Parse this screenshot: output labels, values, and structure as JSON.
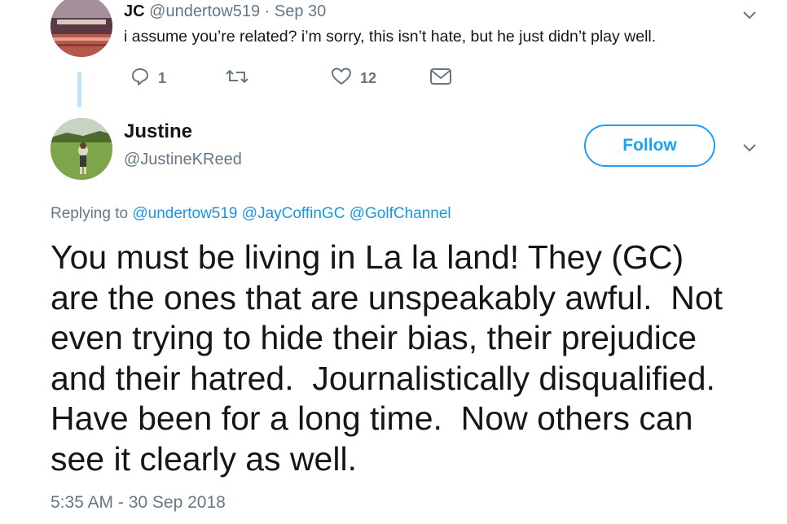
{
  "reply_tweet": {
    "name": "JC",
    "handle": "@undertow519",
    "separator": "·",
    "time": "Sep 30",
    "text": "i assume you’re related? i’m sorry, this isn’t hate, but he just didn’t play well.",
    "actions": {
      "reply_count": "1",
      "retweet_count": "",
      "like_count": "12"
    }
  },
  "main_tweet": {
    "name": "Justine",
    "handle": "@JustineKReed",
    "follow_label": "Follow",
    "replying_prefix": "Replying to",
    "replying_to": [
      "@undertow519",
      "@JayCoffinGC",
      "@GolfChannel"
    ],
    "text_lines": [
      "You must be living in La la land! They (GC)",
      "are the ones that are unspeakably awful.  Not",
      "even trying to hide their bias, their prejudice",
      "and their hatred.  Journalistically disqualified.",
      "Have been for a long time.  Now others can",
      "see it clearly as well."
    ],
    "timestamp": "5:35 AM - 30 Sep 2018"
  },
  "colors": {
    "accent": "#1da1f2",
    "link": "#1b95e0",
    "muted": "#657786",
    "text": "#14171a",
    "thread_line": "#bfe3f7"
  }
}
